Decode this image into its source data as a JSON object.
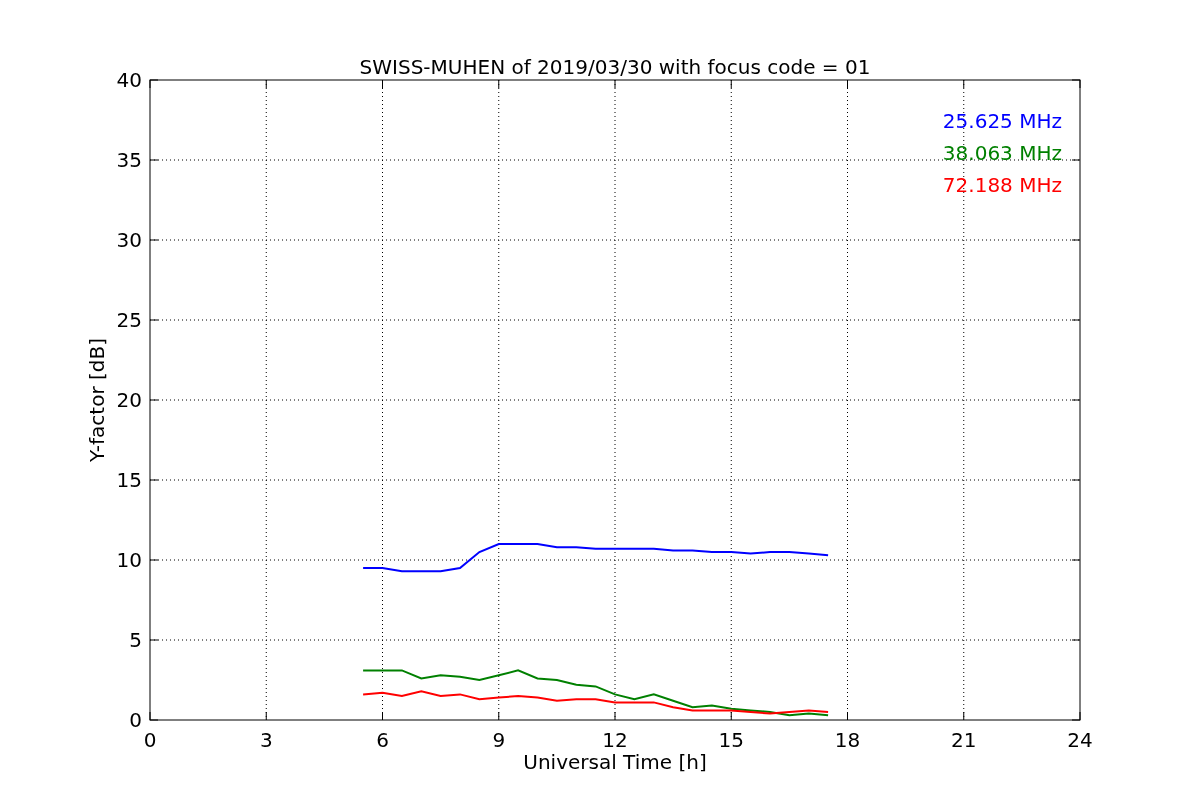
{
  "chart_data": {
    "type": "line",
    "title": "SWISS-MUHEN of 2019/03/30 with focus code = 01",
    "xlabel": "Universal Time [h]",
    "ylabel": "Y-factor [dB]",
    "x": [
      5.5,
      6,
      6.5,
      7,
      7.5,
      8,
      8.5,
      9,
      9.5,
      10,
      10.5,
      11,
      11.5,
      12,
      12.5,
      13,
      13.5,
      14,
      14.5,
      15,
      15.5,
      16,
      16.5,
      17,
      17.5
    ],
    "series": [
      {
        "name": "25.625 MHz",
        "color": "#0000ff",
        "values": [
          9.5,
          9.5,
          9.3,
          9.3,
          9.3,
          9.5,
          10.5,
          11,
          11,
          11,
          10.8,
          10.8,
          10.7,
          10.7,
          10.7,
          10.7,
          10.6,
          10.6,
          10.5,
          10.5,
          10.4,
          10.5,
          10.5,
          10.4,
          10.3
        ]
      },
      {
        "name": "38.063 MHz",
        "color": "#008000",
        "values": [
          3.1,
          3.1,
          3.1,
          2.6,
          2.8,
          2.7,
          2.5,
          2.8,
          3.1,
          2.6,
          2.5,
          2.2,
          2.1,
          1.6,
          1.3,
          1.6,
          1.2,
          0.8,
          0.9,
          0.7,
          0.6,
          0.5,
          0.3,
          0.4,
          0.3
        ]
      },
      {
        "name": "72.188 MHz",
        "color": "#ff0000",
        "values": [
          1.6,
          1.7,
          1.5,
          1.8,
          1.5,
          1.6,
          1.3,
          1.4,
          1.5,
          1.4,
          1.2,
          1.3,
          1.3,
          1.1,
          1.1,
          1.1,
          0.8,
          0.6,
          0.6,
          0.6,
          0.5,
          0.4,
          0.5,
          0.6,
          0.5
        ]
      }
    ],
    "xlim": [
      0,
      24
    ],
    "ylim": [
      0,
      40
    ],
    "xticks": [
      0,
      3,
      6,
      9,
      12,
      15,
      18,
      21,
      24
    ],
    "yticks": [
      0,
      5,
      10,
      15,
      20,
      25,
      30,
      35,
      40
    ],
    "grid": true
  }
}
